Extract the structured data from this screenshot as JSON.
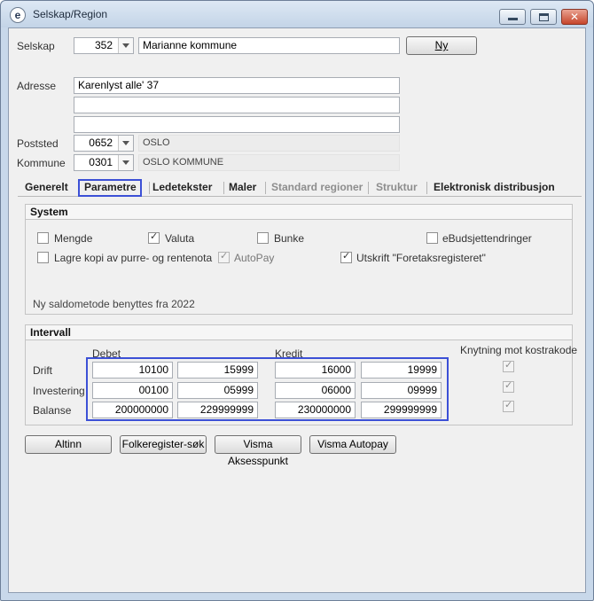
{
  "window": {
    "title": "Selskap/Region",
    "icon_letter": "e"
  },
  "header": {
    "selskap_label": "Selskap",
    "selskap_code": "352",
    "selskap_name": "Marianne kommune",
    "new_button": "Ny",
    "adresse_label": "Adresse",
    "adresse_line1": "Karenlyst alle' 37",
    "adresse_line2": "",
    "adresse_line3": "",
    "poststed_label": "Poststed",
    "poststed_code": "0652",
    "poststed_name": "OSLO",
    "kommune_label": "Kommune",
    "kommune_code": "0301",
    "kommune_name": "OSLO KOMMUNE"
  },
  "tabs": [
    {
      "label": "Generelt"
    },
    {
      "label": "Parametre"
    },
    {
      "label": "Ledetekster"
    },
    {
      "label": "Maler"
    },
    {
      "label": "Standard regioner"
    },
    {
      "label": "Struktur"
    },
    {
      "label": "Elektronisk distribusjon"
    }
  ],
  "system": {
    "title": "System",
    "checkboxes": {
      "mengde": {
        "label": "Mengde",
        "checked": false
      },
      "valuta": {
        "label": "Valuta",
        "checked": true
      },
      "bunke": {
        "label": "Bunke",
        "checked": false
      },
      "ebudsjett": {
        "label": "eBudsjettendringer",
        "checked": false
      },
      "lagre": {
        "label": "Lagre kopi av purre- og rentenota",
        "checked": false
      },
      "autopay": {
        "label": "AutoPay",
        "checked": true
      },
      "utskrift": {
        "label": "Utskrift \"Foretaksregisteret\"",
        "checked": true
      }
    },
    "saldo_text": "Ny saldometode benyttes fra 2022"
  },
  "intervall": {
    "title": "Intervall",
    "debet_label": "Debet",
    "kredit_label": "Kredit",
    "knytning_label": "Knytning mot kostrakode",
    "rows": [
      {
        "label": "Drift",
        "debet_from": "10100",
        "debet_to": "15999",
        "kredit_from": "16000",
        "kredit_to": "19999"
      },
      {
        "label": "Investering",
        "debet_from": "00100",
        "debet_to": "05999",
        "kredit_from": "06000",
        "kredit_to": "09999"
      },
      {
        "label": "Balanse",
        "debet_from": "200000000",
        "debet_to": "229999999",
        "kredit_from": "230000000",
        "kredit_to": "299999999"
      }
    ]
  },
  "buttons": {
    "altinn": "Altinn",
    "folkeregister": "Folkeregister-søk",
    "aksesspunkt": "Visma Aksesspunkt",
    "autopay": "Visma Autopay"
  }
}
